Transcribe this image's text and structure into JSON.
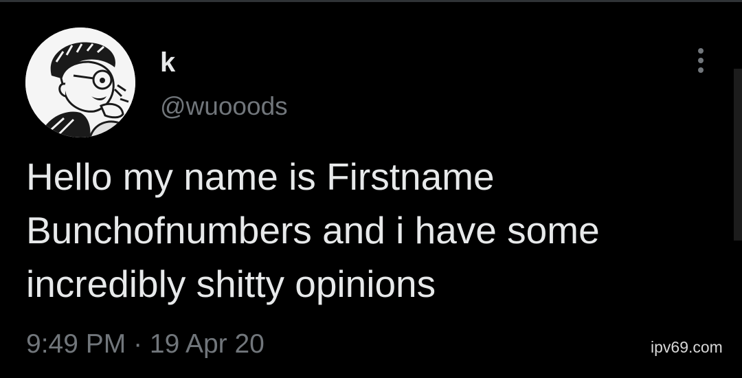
{
  "tweet": {
    "author": {
      "display_name": "k",
      "handle": "@wuooods",
      "avatar_icon": "anime-avatar-icon"
    },
    "text": "Hello my name is Firstname Bunchofnumbers and i have some incredibly shitty opinions",
    "timestamp": "9:49 PM · 19 Apr 20",
    "more_icon": "more-vertical-icon"
  },
  "watermark": "ipv69.com",
  "colors": {
    "background": "#000000",
    "primary_text": "#e7e9ea",
    "secondary_text": "#71767b"
  }
}
